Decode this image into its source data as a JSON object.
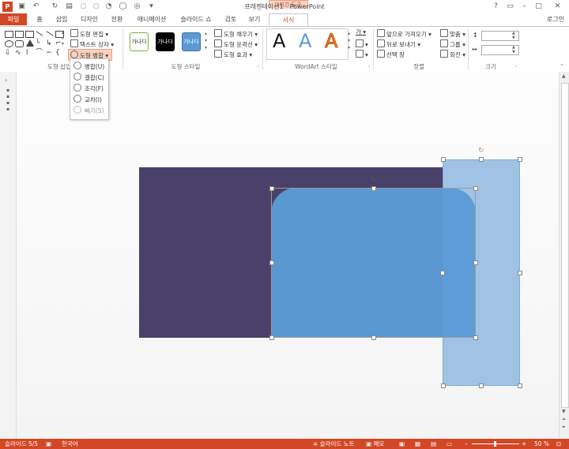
{
  "window": {
    "title": "프레젠테이션1 - PowerPoint",
    "app_logo": "P",
    "contextual_group": "그리기 도구",
    "login": "로그인"
  },
  "tabs": [
    "파일",
    "홈",
    "삽입",
    "디자인",
    "전환",
    "애니메이션",
    "슬라이드 쇼",
    "검토",
    "보기",
    "서식"
  ],
  "ribbon": {
    "insert_shapes": {
      "label": "도형 삽입",
      "edit_shape": "도형 편집",
      "text_box": "텍스트 상자",
      "merge_shapes": "도형 병합"
    },
    "shape_styles": {
      "label": "도형 스타일",
      "swatches": [
        {
          "text": "가나다",
          "bg": "#ffffff",
          "fg": "#333333",
          "border": "#7cb342"
        },
        {
          "text": "가나다",
          "bg": "#000000",
          "fg": "#ffffff",
          "border": "#000000"
        },
        {
          "text": "가나다",
          "bg": "#5b9bd5",
          "fg": "#ffffff",
          "border": "#41719c"
        }
      ],
      "fill": "도형 채우기",
      "outline": "도형 윤곽선",
      "effects": "도형 효과"
    },
    "wordart": {
      "label": "WordArt 스타일",
      "letters": [
        {
          "text": "A",
          "color": "#111111"
        },
        {
          "text": "A",
          "color": "#5b9bd5"
        },
        {
          "text": "A",
          "color": "#ed7d31"
        }
      ],
      "text_glyph": "가"
    },
    "arrange": {
      "label": "정렬",
      "bring_forward": "앞으로 가져오기",
      "send_backward": "뒤로 보내기",
      "selection_pane": "선택 창",
      "align": "맞춤",
      "group": "그룹",
      "rotate": "회전"
    },
    "size": {
      "label": "크기",
      "height": "",
      "width": ""
    }
  },
  "merge_menu": {
    "items": [
      "병합(U)",
      "결합(C)",
      "조각(F)",
      "교차(I)",
      "빼기(S)"
    ]
  },
  "colors": {
    "accent": "#d24726",
    "dark_rect": "#4a416a",
    "rounded_rect": "#5b9bd5",
    "tall_rect": "#9cc1e4"
  },
  "statusbar": {
    "slide": "슬라이드 5/5",
    "language": "한국어",
    "notes": "슬라이드 노트",
    "comments": "메모",
    "zoom": "50 %"
  }
}
